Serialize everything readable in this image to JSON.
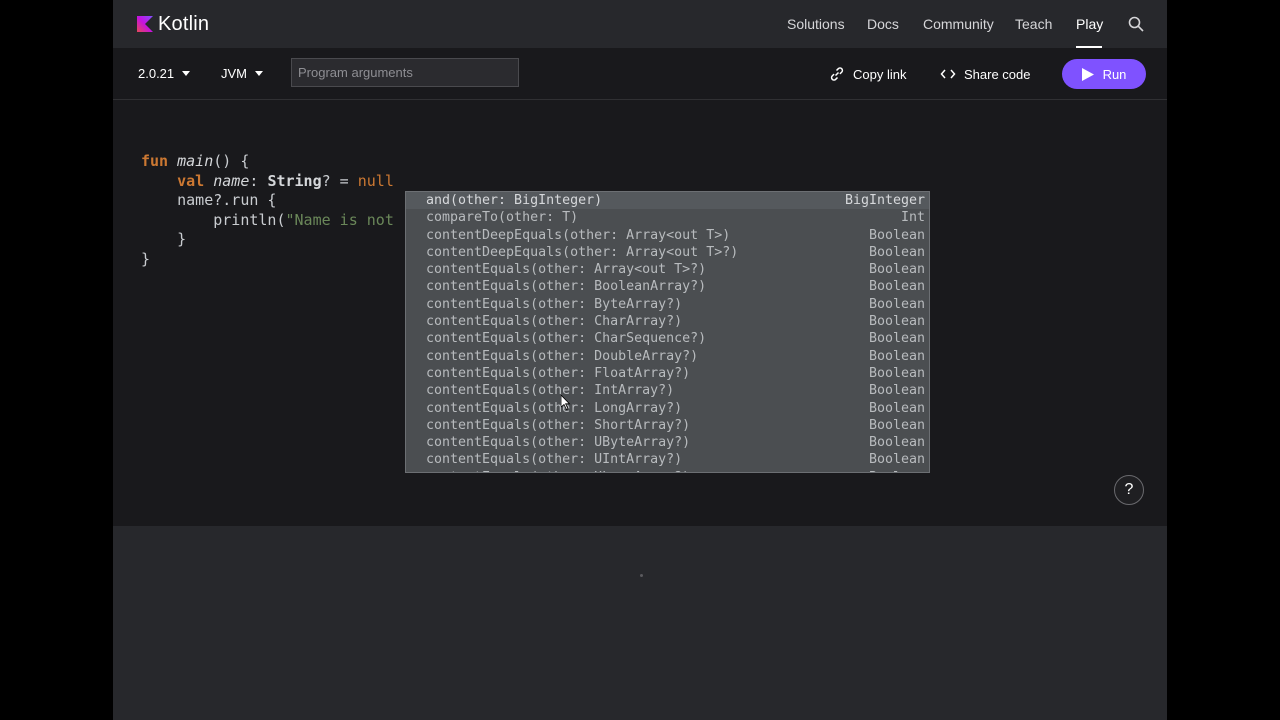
{
  "brand": {
    "name": "Kotlin"
  },
  "nav": {
    "items": [
      {
        "label": "Solutions",
        "active": false
      },
      {
        "label": "Docs",
        "active": false
      },
      {
        "label": "Community",
        "active": false
      },
      {
        "label": "Teach",
        "active": false
      },
      {
        "label": "Play",
        "active": true
      }
    ],
    "search_icon": "search-icon"
  },
  "toolbar": {
    "version": "2.0.21",
    "platform": "JVM",
    "args_placeholder": "Program arguments",
    "copy_link": "Copy link",
    "share_code": "Share code",
    "run": "Run"
  },
  "editor": {
    "lines": [
      "fun main() {",
      "    val name: String? = null",
      "    name?.run {",
      "        println(\"Name is not",
      "    }",
      "}"
    ]
  },
  "autocomplete": {
    "items": [
      {
        "signature": "and(other: BigInteger)",
        "type": "BigInteger"
      },
      {
        "signature": "compareTo(other: T)",
        "type": "Int"
      },
      {
        "signature": "contentDeepEquals(other: Array<out T>)",
        "type": "Boolean"
      },
      {
        "signature": "contentDeepEquals(other: Array<out T>?)",
        "type": "Boolean"
      },
      {
        "signature": "contentEquals(other: Array<out T>?)",
        "type": "Boolean"
      },
      {
        "signature": "contentEquals(other: BooleanArray?)",
        "type": "Boolean"
      },
      {
        "signature": "contentEquals(other: ByteArray?)",
        "type": "Boolean"
      },
      {
        "signature": "contentEquals(other: CharArray?)",
        "type": "Boolean"
      },
      {
        "signature": "contentEquals(other: CharSequence?)",
        "type": "Boolean"
      },
      {
        "signature": "contentEquals(other: DoubleArray?)",
        "type": "Boolean"
      },
      {
        "signature": "contentEquals(other: FloatArray?)",
        "type": "Boolean"
      },
      {
        "signature": "contentEquals(other: IntArray?)",
        "type": "Boolean"
      },
      {
        "signature": "contentEquals(other: LongArray?)",
        "type": "Boolean"
      },
      {
        "signature": "contentEquals(other: ShortArray?)",
        "type": "Boolean"
      },
      {
        "signature": "contentEquals(other: UByteArray?)",
        "type": "Boolean"
      },
      {
        "signature": "contentEquals(other: UIntArray?)",
        "type": "Boolean"
      },
      {
        "signature": "contentEquals(other: ULongArray?)",
        "type": "Boolean"
      }
    ]
  },
  "help": {
    "label": "?"
  },
  "colors": {
    "accent": "#7f52ff",
    "keyword": "#cc7832",
    "string": "#6a8759"
  }
}
